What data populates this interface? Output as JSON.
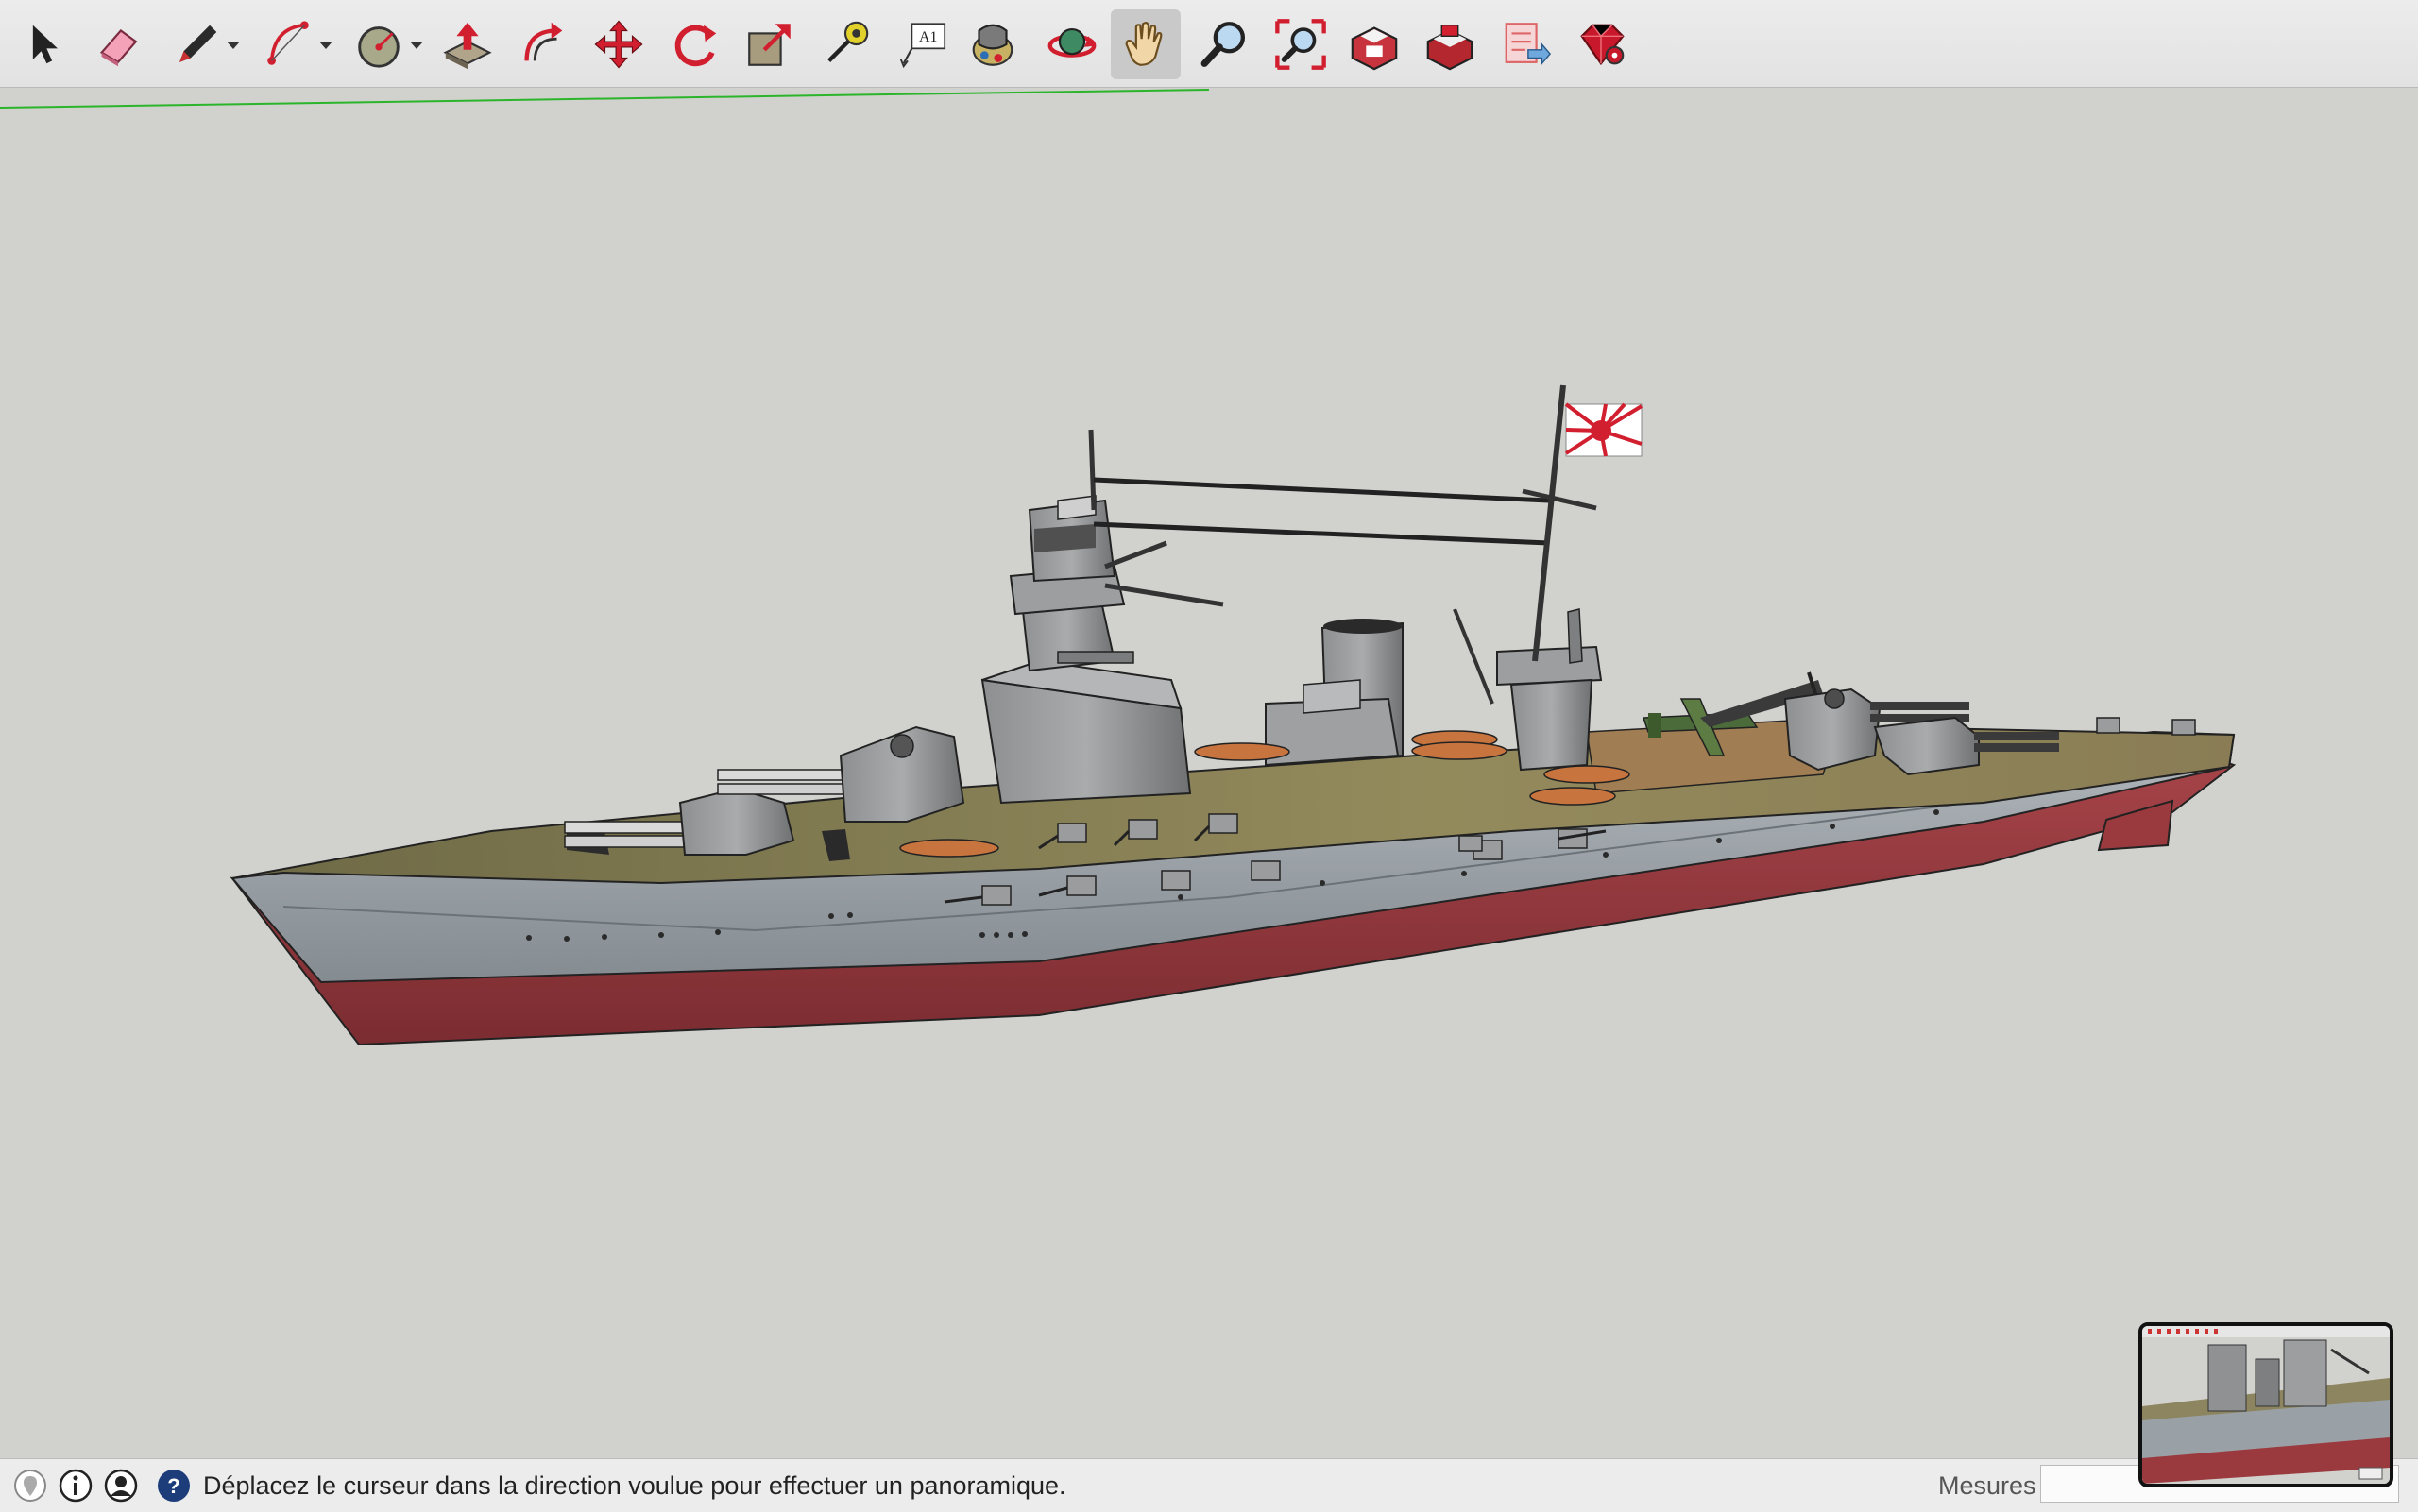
{
  "app": {
    "name": "SketchUp"
  },
  "toolbar": {
    "tools": [
      {
        "name": "select-tool",
        "icon": "arrow-pointer-icon"
      },
      {
        "name": "eraser-tool",
        "icon": "eraser-icon"
      },
      {
        "name": "line-tool",
        "icon": "pencil-icon",
        "has_menu": true
      },
      {
        "name": "arc-tool",
        "icon": "arc-icon",
        "has_menu": true
      },
      {
        "name": "shape-tool",
        "icon": "circle-shape-icon",
        "has_menu": true
      },
      {
        "name": "push-pull-tool",
        "icon": "push-pull-icon"
      },
      {
        "name": "offset-tool",
        "icon": "offset-icon"
      },
      {
        "name": "move-tool",
        "icon": "move-arrows-icon"
      },
      {
        "name": "rotate-tool",
        "icon": "rotate-icon"
      },
      {
        "name": "scale-tool",
        "icon": "scale-icon"
      },
      {
        "name": "tape-measure-tool",
        "icon": "tape-measure-icon"
      },
      {
        "name": "text-tool",
        "icon": "text-label-icon",
        "label": "A1"
      },
      {
        "name": "paint-bucket-tool",
        "icon": "paint-bucket-icon"
      },
      {
        "name": "orbit-tool",
        "icon": "orbit-icon"
      },
      {
        "name": "pan-tool",
        "icon": "hand-icon",
        "active": true
      },
      {
        "name": "zoom-tool",
        "icon": "magnifier-icon"
      },
      {
        "name": "zoom-extents-tool",
        "icon": "zoom-extents-icon"
      },
      {
        "name": "3d-warehouse-button",
        "icon": "warehouse-icon"
      },
      {
        "name": "extension-warehouse-button",
        "icon": "extension-warehouse-icon"
      },
      {
        "name": "send-to-layout-button",
        "icon": "layout-icon"
      },
      {
        "name": "ruby-console-button",
        "icon": "ruby-gem-icon"
      }
    ]
  },
  "model": {
    "subject": "battleship model",
    "flag": "rising-sun-flag"
  },
  "colors": {
    "background": "#d1d1cd",
    "hull_gray": "#9aa1a6",
    "hull_red": "#9b3a3e",
    "deck": "#8c8560",
    "axis_green": "#2bb52b"
  },
  "status": {
    "message": "Déplacez le curseur dans la direction voulue pour effectuer un panoramique.",
    "measures_label": "Mesures",
    "measures_value": ""
  }
}
